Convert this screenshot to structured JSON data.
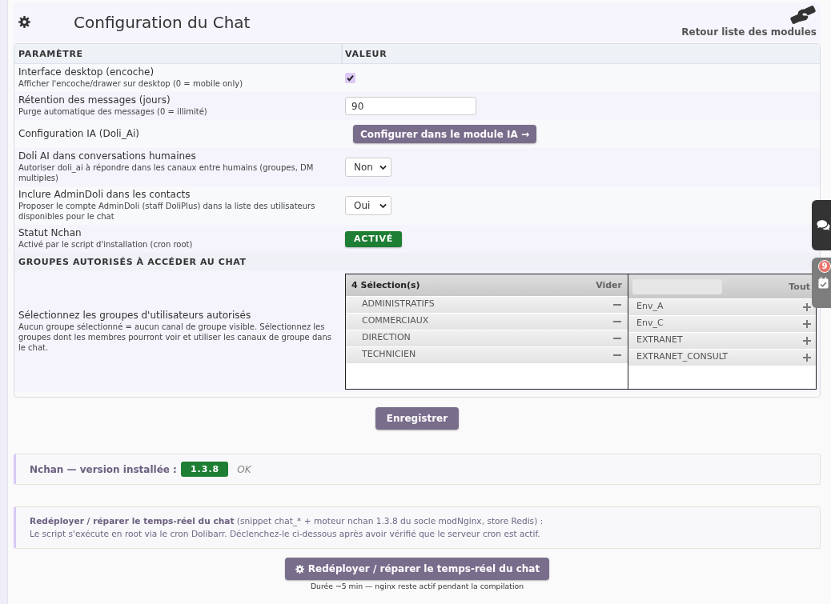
{
  "header": {
    "title": "Configuration du Chat",
    "back_link": "Retour liste des modules"
  },
  "table": {
    "columns": [
      "PARAMÈTRE",
      "VALEUR"
    ],
    "rows": [
      {
        "kind": "checkbox",
        "label": "Interface desktop (encoche)",
        "description": "Afficher l'encoche/drawer sur desktop (0 = mobile only)",
        "checked": true
      },
      {
        "kind": "input",
        "label": "Rétention des messages (jours)",
        "description": "Purge automatique des messages (0 = illimité)",
        "value": "90"
      },
      {
        "kind": "button",
        "label": "Configuration IA (Doli_Ai)",
        "button": "Configurer dans le module IA →"
      },
      {
        "kind": "select",
        "label": "Doli AI dans conversations humaines",
        "description": "Autoriser doli_ai à répondre dans les canaux entre humains (groupes, DM multiples)",
        "value": "Non"
      },
      {
        "kind": "select",
        "label": "Inclure AdminDoli dans les contacts",
        "description": "Proposer le compte AdminDoli (staff DoliPlus) dans la liste des utilisateurs disponibles pour le chat",
        "value": "Oui"
      },
      {
        "kind": "badge",
        "label": "Statut Nchan",
        "description": "Activé par le script d'installation (cron root)",
        "badge": "ACTIVÉ"
      }
    ],
    "section": "GROUPES AUTORISÉS À ACCÉDER AU CHAT",
    "groups": {
      "label": "Sélectionnez les groupes d'utilisateurs autorisés",
      "description": "Aucun groupe sélectionné = aucun canal de groupe visible. Sélectionnez les groupes dont les membres pourront voir et utiliser les canaux de groupe dans le chat.",
      "selected_count": "4 Sélection(s)",
      "clear_link": "Vider",
      "selected": [
        "ADMINISTRATIFS",
        "COMMERCIAUX",
        "DIRECTION",
        "TECHNICIEN"
      ],
      "select_all_link": "Tout",
      "available": [
        "Env_A",
        "Env_C",
        "EXTRANET",
        "EXTRANET_CONSULT"
      ]
    }
  },
  "save_button": "Enregistrer",
  "nchan_status": {
    "label": "Nchan — version installée :",
    "version": "1.3.8",
    "status": "OK"
  },
  "redeploy": {
    "notice_title": "Redéployer / réparer le temps-réel du chat",
    "notice_detail": "(snippet chat_* + moteur nchan 1.3.8 du socle modNginx, store Redis) :",
    "notice_body": "Le script s'exécute en root via le cron Dolibarr. Déclenchez-le ci-dessous après avoir vérifié que le serveur cron est actif.",
    "button": "Redéployer / réparer le temps-réel du chat",
    "note": "Durée ~5 min — nginx reste actif pendant la compilation"
  },
  "side_tabs": [
    {
      "kind": "chat"
    },
    {
      "kind": "calendar",
      "badge": "9"
    }
  ]
}
